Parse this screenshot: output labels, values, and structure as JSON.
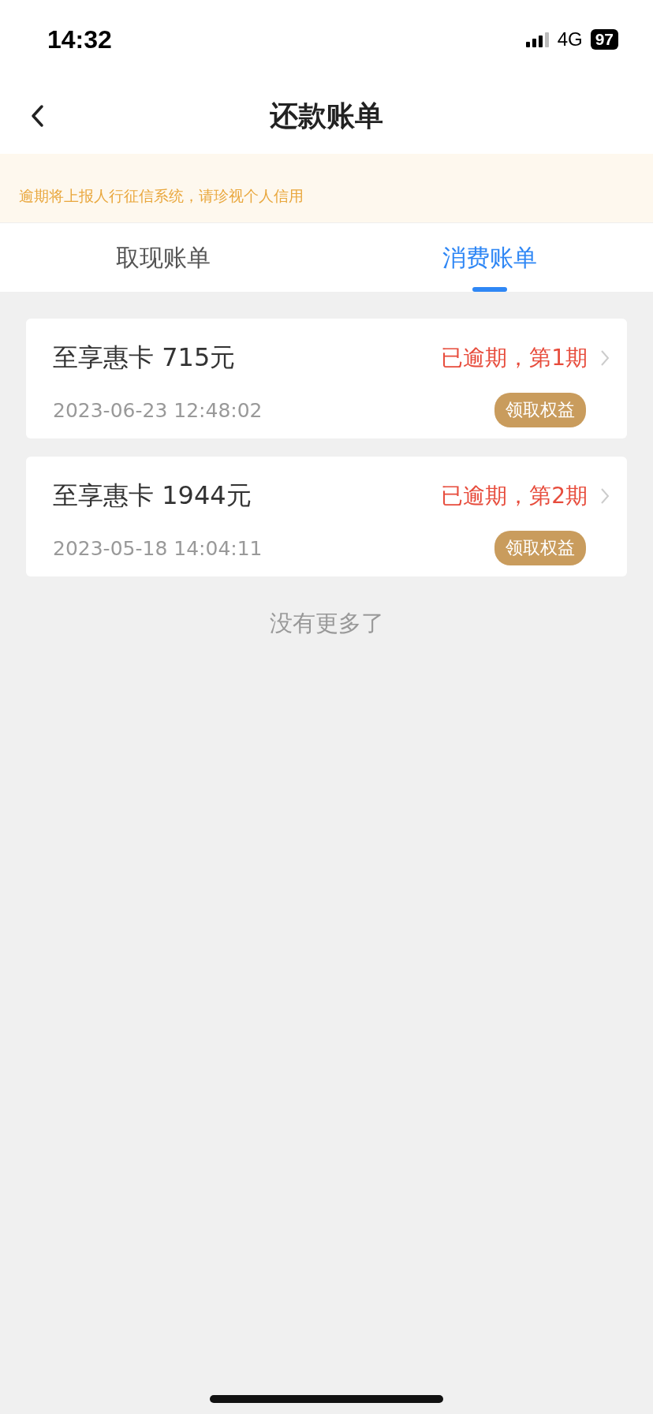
{
  "status_bar": {
    "time": "14:32",
    "network": "4G",
    "battery": "97"
  },
  "nav": {
    "title": "还款账单"
  },
  "notice": "逾期将上报人行征信系统，请珍视个人信用",
  "tabs": [
    {
      "label": "取现账单",
      "selected": false
    },
    {
      "label": "消费账单",
      "selected": true
    }
  ],
  "bills": [
    {
      "title": "至享惠卡 715元",
      "status": "已逾期，第1期",
      "date": "2023-06-23 12:48:02",
      "action": "领取权益"
    },
    {
      "title": "至享惠卡 1944元",
      "status": "已逾期，第2期",
      "date": "2023-05-18 14:04:11",
      "action": "领取权益"
    }
  ],
  "footer": "没有更多了"
}
